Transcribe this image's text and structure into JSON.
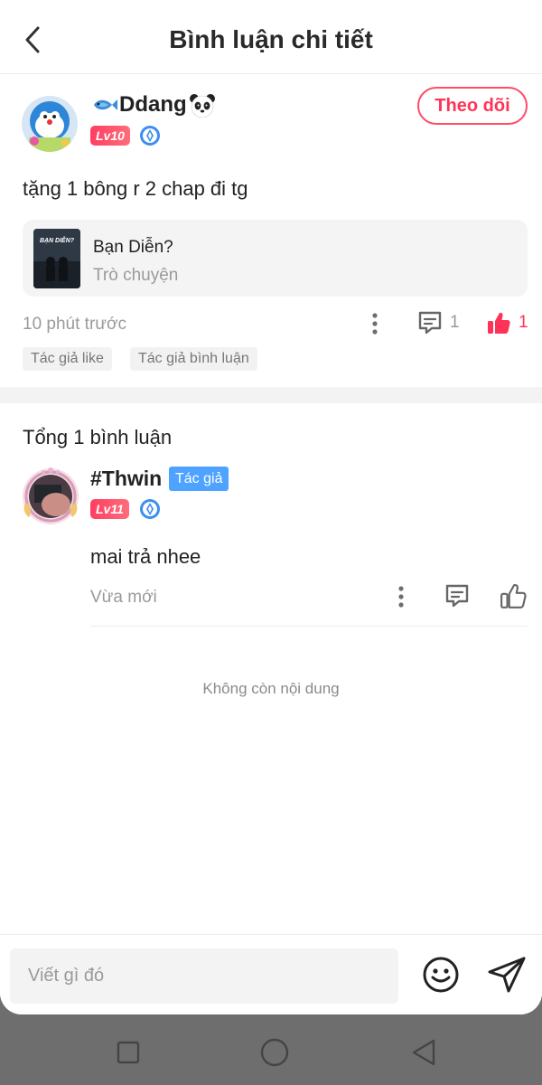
{
  "header": {
    "title": "Bình luận chi tiết"
  },
  "comment": {
    "username": "Ddang",
    "level": "Lv10",
    "follow_label": "Theo dõi",
    "text": "tặng 1 bông r 2 chap đi tg",
    "story": {
      "title": "Bạn Diễn?",
      "subtitle": "Trò chuyện",
      "cover_text": "BẠN DIỄN?"
    },
    "time": "10 phút trước",
    "reply_count": "1",
    "like_count": "1",
    "tags": [
      "Tác giả like",
      "Tác giả bình luận"
    ]
  },
  "replies_section": {
    "total_label": "Tổng 1 bình luận"
  },
  "reply": {
    "username": "#Thwin",
    "author_tag": "Tác giả",
    "level": "Lv11",
    "text": "mai trả nhee",
    "time": "Vừa mới"
  },
  "end_message": "Không còn nội dung",
  "input": {
    "placeholder": "Viết gì đó"
  },
  "colors": {
    "accent": "#ff3358",
    "author_tag": "#4da3ff",
    "muted": "#9a9a9a"
  },
  "icons": {
    "back": "chevron-left-icon",
    "more": "more-vertical-icon",
    "reply": "chat-icon",
    "like": "thumbs-up-icon",
    "emoji": "smile-icon",
    "send": "send-icon"
  }
}
